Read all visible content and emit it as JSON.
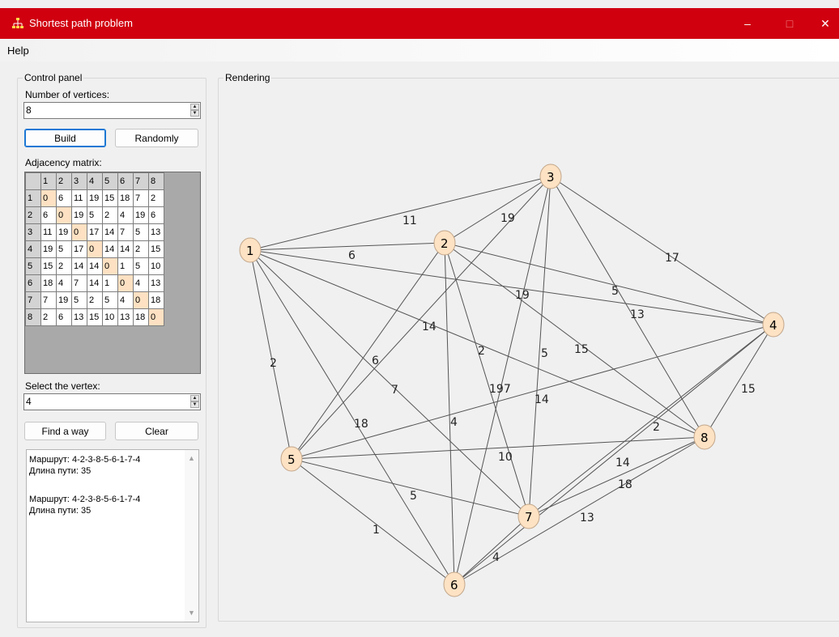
{
  "window": {
    "title": "Shortest path problem",
    "minimize_glyph": "–",
    "maximize_glyph": "□",
    "close_glyph": "✕",
    "accent": "#d0000f"
  },
  "menu": {
    "help": "Help"
  },
  "control_panel": {
    "legend": "Control panel",
    "vertices_label": "Number of vertices:",
    "vertices_value": "8",
    "build_label": "Build",
    "randomly_label": "Randomly",
    "matrix_label": "Adjacency matrix:",
    "matrix_headers": [
      "1",
      "2",
      "3",
      "4",
      "5",
      "6",
      "7",
      "8"
    ],
    "matrix": [
      [
        "0",
        "6",
        "11",
        "19",
        "15",
        "18",
        "7",
        "2"
      ],
      [
        "6",
        "0",
        "19",
        "5",
        "2",
        "4",
        "19",
        "6"
      ],
      [
        "11",
        "19",
        "0",
        "17",
        "14",
        "7",
        "5",
        "13"
      ],
      [
        "19",
        "5",
        "17",
        "0",
        "14",
        "14",
        "2",
        "15"
      ],
      [
        "15",
        "2",
        "14",
        "14",
        "0",
        "1",
        "5",
        "10"
      ],
      [
        "18",
        "4",
        "7",
        "14",
        "1",
        "0",
        "4",
        "13"
      ],
      [
        "7",
        "19",
        "5",
        "2",
        "5",
        "4",
        "0",
        "18"
      ],
      [
        "2",
        "6",
        "13",
        "15",
        "10",
        "13",
        "18",
        "0"
      ]
    ],
    "select_label": "Select the vertex:",
    "select_value": "4",
    "find_label": "Find a way",
    "clear_label": "Clear",
    "output_lines": [
      "Маршрут: 4-2-3-8-5-6-1-7-4",
      "Длина пути: 35",
      "",
      "Маршрут: 4-2-3-8-5-6-1-7-4",
      "Длина пути: 35"
    ]
  },
  "rendering": {
    "legend": "Rendering",
    "node_color": "#fde2c3",
    "nodes": [
      {
        "id": "1"
      },
      {
        "id": "2"
      },
      {
        "id": "3"
      },
      {
        "id": "4"
      },
      {
        "id": "5"
      },
      {
        "id": "6"
      },
      {
        "id": "7"
      },
      {
        "id": "8"
      }
    ],
    "edges": [
      [
        "1",
        "2"
      ],
      [
        "1",
        "3"
      ],
      [
        "1",
        "4"
      ],
      [
        "1",
        "5"
      ],
      [
        "1",
        "6"
      ],
      [
        "1",
        "7"
      ],
      [
        "1",
        "8"
      ],
      [
        "2",
        "3"
      ],
      [
        "2",
        "4"
      ],
      [
        "2",
        "5"
      ],
      [
        "2",
        "6"
      ],
      [
        "2",
        "7"
      ],
      [
        "2",
        "8"
      ],
      [
        "3",
        "4"
      ],
      [
        "3",
        "5"
      ],
      [
        "3",
        "6"
      ],
      [
        "3",
        "7"
      ],
      [
        "3",
        "8"
      ],
      [
        "4",
        "5"
      ],
      [
        "4",
        "6"
      ],
      [
        "4",
        "7"
      ],
      [
        "4",
        "8"
      ],
      [
        "5",
        "6"
      ],
      [
        "5",
        "7"
      ],
      [
        "5",
        "8"
      ],
      [
        "6",
        "7"
      ],
      [
        "6",
        "8"
      ],
      [
        "7",
        "8"
      ]
    ],
    "weight_labels": [
      "11",
      "19",
      "6",
      "17",
      "5",
      "19",
      "13",
      "14",
      "2",
      "6",
      "15",
      "2",
      "5",
      "15",
      "197",
      "14",
      "7",
      "4",
      "18",
      "2",
      "10",
      "14",
      "5",
      "18",
      "1",
      "13",
      "4"
    ]
  }
}
